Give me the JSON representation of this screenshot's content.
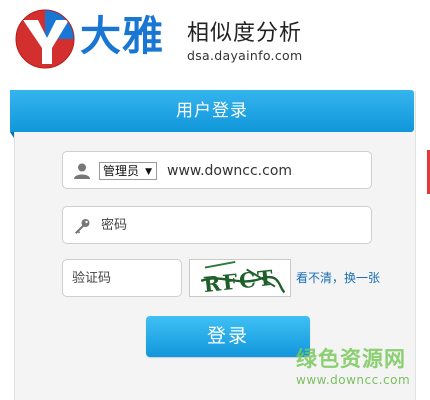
{
  "header": {
    "brand_name": "大雅",
    "brand_subtitle": "相似度分析",
    "brand_url": "dsa.dayainfo.com"
  },
  "login_panel": {
    "title": "用户登录",
    "role_select": {
      "selected": "管理员"
    },
    "username_value": "www.downcc.com",
    "password_placeholder": "密码",
    "captcha_placeholder": "验证码",
    "captcha_text": "RFCT",
    "refresh_link": "看不清，换一张",
    "submit_label": "登录"
  },
  "watermark": {
    "title": "绿色资源网",
    "url": "www.downcc.com"
  },
  "colors": {
    "accent": "#1096da",
    "brand_blue": "#1976d2",
    "logo_red": "#d32f2f",
    "captcha_ink": "#1f5f2a"
  },
  "icons": {
    "logo": "daya-logo-icon",
    "user": "user-icon",
    "password": "key-icon",
    "select": "chevron-down-icon"
  }
}
